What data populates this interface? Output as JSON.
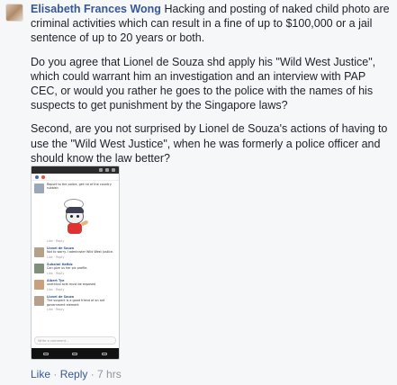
{
  "comment": {
    "author": "Elisabeth Frances Wong",
    "paragraphs": [
      "Hacking and posting of naked child photo are criminal activities which can result in a fine of up to $100,000 or a jail sentence of up to 20 years or both.",
      "Do you agree that Lionel de Souza shd apply his \"Wild West Justice\", which could warrant him an investigation and an interview with PAP CEC, or would you rather he goes to the police with the names of his suspects to get punishment by the Singapore laws?",
      "Second, are you not surprised by Lionel de Souza's actions of having to use the \"Wild West Justice\", when he was formerly a police officer and should know the law better?"
    ],
    "actions": {
      "like": "Like",
      "separator": " · ",
      "reply": "Reply",
      "time": "7 hrs"
    }
  },
  "attachment": {
    "rows": [
      {
        "name": "",
        "text": "Report to the police, get rid of the country rubbish",
        "meta": "Like · Reply"
      },
      {
        "name": "Lionel de Souza",
        "text": "Not to worry. I administer Wild West Justice.",
        "meta": "Like · Reply"
      },
      {
        "name": "Suhaimi Hafidz",
        "text": "Can give us her pic profile.",
        "meta": "Like · Reply"
      },
      {
        "name": "Albert Tye",
        "text": "unethical acts must be exposed",
        "meta": "Like · Reply"
      },
      {
        "name": "Lionel de Souza",
        "text": "The suspect is a good friend of an ant government element",
        "meta": "Like · Reply"
      }
    ],
    "input_placeholder": "Write a comment..."
  }
}
